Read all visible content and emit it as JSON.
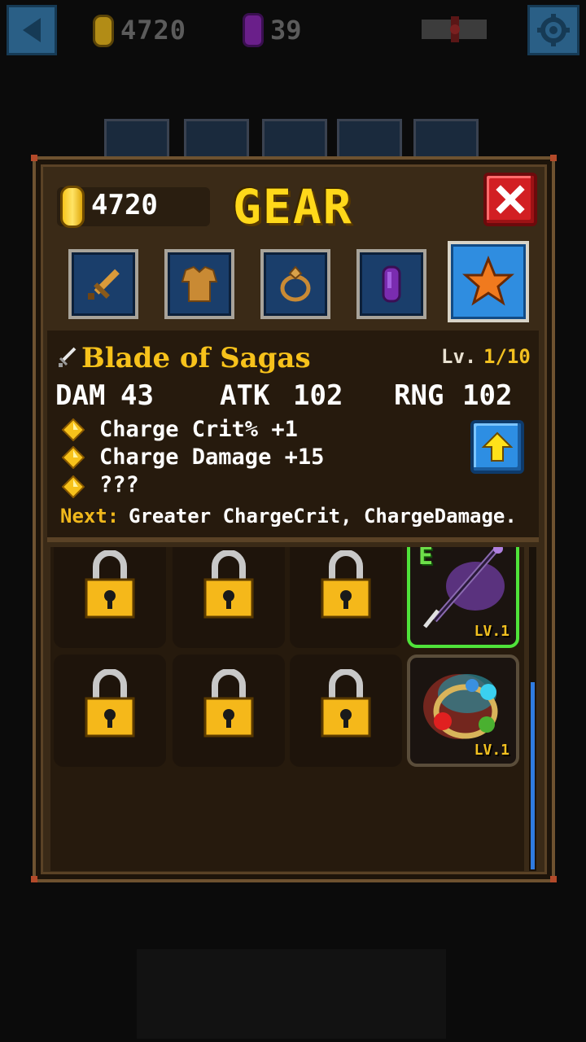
{
  "hud": {
    "gold": "4720",
    "gems": "39",
    "icons": [
      "back-arrow-icon",
      "gold-coin-icon",
      "purple-gem-icon",
      "scroll-map-icon",
      "gear-icon"
    ]
  },
  "panel": {
    "gold": "4720",
    "title": "GEAR",
    "close_label": "X",
    "tabs": [
      {
        "name": "weapon",
        "icon": "sword-icon"
      },
      {
        "name": "armor",
        "icon": "armor-icon"
      },
      {
        "name": "ring",
        "icon": "ring-icon"
      },
      {
        "name": "gem",
        "icon": "gem-icon"
      },
      {
        "name": "special",
        "icon": "star-icon",
        "active": true
      }
    ]
  },
  "item": {
    "name": "Blade of Sagas",
    "level_label": "Lv.",
    "level_value": "1/10",
    "stats": [
      {
        "label": "DAM",
        "value": "43"
      },
      {
        "label": "ATK",
        "value": "102"
      },
      {
        "label": "RNG",
        "value": "102"
      }
    ],
    "bonuses": [
      "Charge Crit% +1",
      "Charge Damage +15",
      "???"
    ],
    "next_label": "Next:",
    "next_value": "Greater ChargeCrit, ChargeDamage."
  },
  "grid": {
    "slots": [
      {
        "state": "locked"
      },
      {
        "state": "locked"
      },
      {
        "state": "locked"
      },
      {
        "state": "equipped",
        "badge": "E",
        "level": "LV.1",
        "item": "staff"
      },
      {
        "state": "locked"
      },
      {
        "state": "locked"
      },
      {
        "state": "locked"
      },
      {
        "state": "owned",
        "level": "LV.1",
        "item": "ring"
      }
    ]
  },
  "colors": {
    "title": "#ffd81a",
    "accent_gold": "#f2c020",
    "equipped_border": "#4fe23a",
    "close": "#d21f23",
    "upgrade": "#2d8ee3"
  }
}
